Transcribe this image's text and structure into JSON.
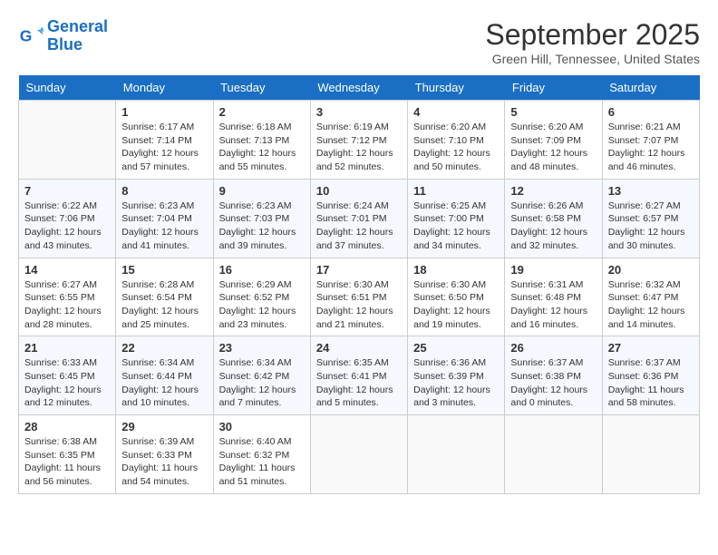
{
  "header": {
    "logo_line1": "General",
    "logo_line2": "Blue",
    "month": "September 2025",
    "location": "Green Hill, Tennessee, United States"
  },
  "days_of_week": [
    "Sunday",
    "Monday",
    "Tuesday",
    "Wednesday",
    "Thursday",
    "Friday",
    "Saturday"
  ],
  "weeks": [
    [
      {
        "day": "",
        "empty": true
      },
      {
        "day": "1",
        "rise": "6:17 AM",
        "set": "7:14 PM",
        "hours": "12 hours and 57 minutes."
      },
      {
        "day": "2",
        "rise": "6:18 AM",
        "set": "7:13 PM",
        "hours": "12 hours and 55 minutes."
      },
      {
        "day": "3",
        "rise": "6:19 AM",
        "set": "7:12 PM",
        "hours": "12 hours and 52 minutes."
      },
      {
        "day": "4",
        "rise": "6:20 AM",
        "set": "7:10 PM",
        "hours": "12 hours and 50 minutes."
      },
      {
        "day": "5",
        "rise": "6:20 AM",
        "set": "7:09 PM",
        "hours": "12 hours and 48 minutes."
      },
      {
        "day": "6",
        "rise": "6:21 AM",
        "set": "7:07 PM",
        "hours": "12 hours and 46 minutes."
      }
    ],
    [
      {
        "day": "7",
        "rise": "6:22 AM",
        "set": "7:06 PM",
        "hours": "12 hours and 43 minutes."
      },
      {
        "day": "8",
        "rise": "6:23 AM",
        "set": "7:04 PM",
        "hours": "12 hours and 41 minutes."
      },
      {
        "day": "9",
        "rise": "6:23 AM",
        "set": "7:03 PM",
        "hours": "12 hours and 39 minutes."
      },
      {
        "day": "10",
        "rise": "6:24 AM",
        "set": "7:01 PM",
        "hours": "12 hours and 37 minutes."
      },
      {
        "day": "11",
        "rise": "6:25 AM",
        "set": "7:00 PM",
        "hours": "12 hours and 34 minutes."
      },
      {
        "day": "12",
        "rise": "6:26 AM",
        "set": "6:58 PM",
        "hours": "12 hours and 32 minutes."
      },
      {
        "day": "13",
        "rise": "6:27 AM",
        "set": "6:57 PM",
        "hours": "12 hours and 30 minutes."
      }
    ],
    [
      {
        "day": "14",
        "rise": "6:27 AM",
        "set": "6:55 PM",
        "hours": "12 hours and 28 minutes."
      },
      {
        "day": "15",
        "rise": "6:28 AM",
        "set": "6:54 PM",
        "hours": "12 hours and 25 minutes."
      },
      {
        "day": "16",
        "rise": "6:29 AM",
        "set": "6:52 PM",
        "hours": "12 hours and 23 minutes."
      },
      {
        "day": "17",
        "rise": "6:30 AM",
        "set": "6:51 PM",
        "hours": "12 hours and 21 minutes."
      },
      {
        "day": "18",
        "rise": "6:30 AM",
        "set": "6:50 PM",
        "hours": "12 hours and 19 minutes."
      },
      {
        "day": "19",
        "rise": "6:31 AM",
        "set": "6:48 PM",
        "hours": "12 hours and 16 minutes."
      },
      {
        "day": "20",
        "rise": "6:32 AM",
        "set": "6:47 PM",
        "hours": "12 hours and 14 minutes."
      }
    ],
    [
      {
        "day": "21",
        "rise": "6:33 AM",
        "set": "6:45 PM",
        "hours": "12 hours and 12 minutes."
      },
      {
        "day": "22",
        "rise": "6:34 AM",
        "set": "6:44 PM",
        "hours": "12 hours and 10 minutes."
      },
      {
        "day": "23",
        "rise": "6:34 AM",
        "set": "6:42 PM",
        "hours": "12 hours and 7 minutes."
      },
      {
        "day": "24",
        "rise": "6:35 AM",
        "set": "6:41 PM",
        "hours": "12 hours and 5 minutes."
      },
      {
        "day": "25",
        "rise": "6:36 AM",
        "set": "6:39 PM",
        "hours": "12 hours and 3 minutes."
      },
      {
        "day": "26",
        "rise": "6:37 AM",
        "set": "6:38 PM",
        "hours": "12 hours and 0 minutes."
      },
      {
        "day": "27",
        "rise": "6:37 AM",
        "set": "6:36 PM",
        "hours": "11 hours and 58 minutes."
      }
    ],
    [
      {
        "day": "28",
        "rise": "6:38 AM",
        "set": "6:35 PM",
        "hours": "11 hours and 56 minutes."
      },
      {
        "day": "29",
        "rise": "6:39 AM",
        "set": "6:33 PM",
        "hours": "11 hours and 54 minutes."
      },
      {
        "day": "30",
        "rise": "6:40 AM",
        "set": "6:32 PM",
        "hours": "11 hours and 51 minutes."
      },
      {
        "day": "",
        "empty": true
      },
      {
        "day": "",
        "empty": true
      },
      {
        "day": "",
        "empty": true
      },
      {
        "day": "",
        "empty": true
      }
    ]
  ]
}
